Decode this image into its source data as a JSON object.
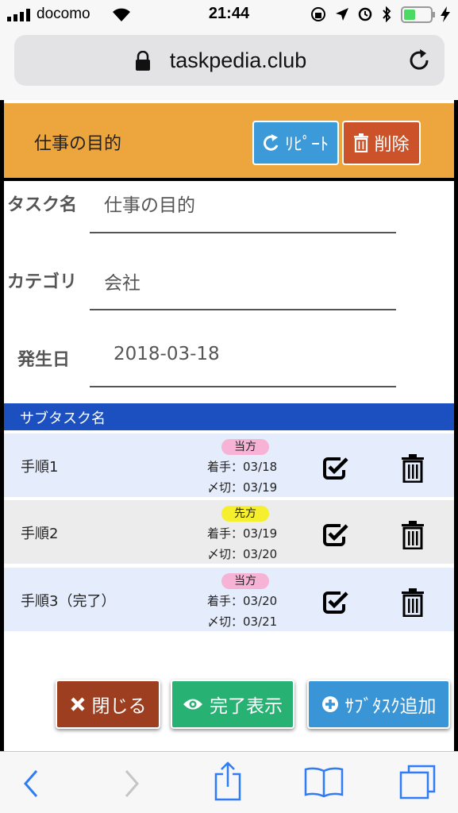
{
  "status_bar": {
    "carrier": "docomo",
    "time": "21:44"
  },
  "url_bar": {
    "url": "taskpedia.club"
  },
  "task": {
    "title": "仕事の目的",
    "repeat_label": "ﾘﾋﾟｰﾄ",
    "delete_label": "削除",
    "fields": [
      {
        "label": "タスク名",
        "value": "仕事の目的"
      },
      {
        "label": "カテゴリ",
        "value": "会社"
      },
      {
        "label": "発生日",
        "value": "2018-03-18"
      }
    ]
  },
  "subtasks": {
    "header": "サブタスク名",
    "rows": [
      {
        "name": "手順1",
        "badge": "当方",
        "start": "着手：03/18",
        "deadline": "〆切：03/19"
      },
      {
        "name": "手順2",
        "badge": "先方",
        "start": "着手：03/19",
        "deadline": "〆切：03/20"
      },
      {
        "name": "手順3（完了）",
        "badge": "当方",
        "start": "着手：03/20",
        "deadline": "〆切：03/21"
      }
    ]
  },
  "actions": {
    "close_label": "閉じる",
    "show_done_label": "完了表示",
    "add_subtask_label": "ｻﾌﾞﾀｽｸ追加"
  },
  "colors": {
    "header_bg": "#eda63e",
    "row_light_blue": "#e5ecfb",
    "row_gray": "#ececec",
    "subtask_header": "#1c4fbf",
    "badge_pink": "#f7b3d6",
    "badge_yellow": "#f5ef2e",
    "ios_blue": "#2f7df6"
  }
}
